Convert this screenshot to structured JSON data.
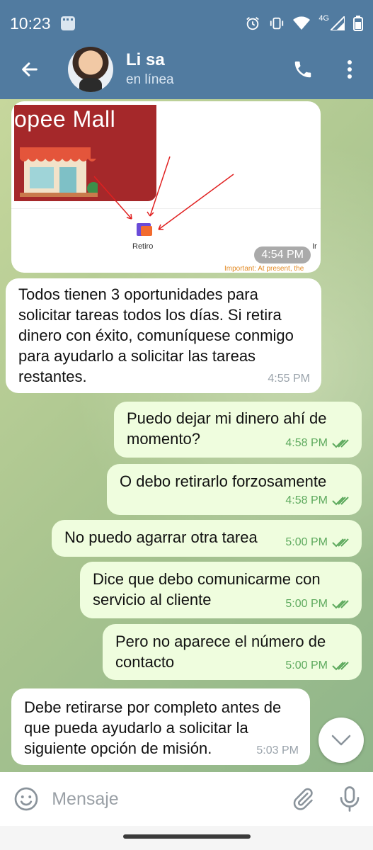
{
  "status_bar": {
    "time": "10:23",
    "network": "4G"
  },
  "header": {
    "title": "Li sa",
    "status": "en línea"
  },
  "image_message": {
    "banner_text": "opee Mall",
    "retiro_label": "Retiro",
    "side_label": "Ir",
    "important_text": "Important: At present, the",
    "time": "4:54 PM"
  },
  "messages": [
    {
      "direction": "in",
      "text": "Todos tienen 3 oportunidades para solicitar tareas todos los días. Si retira dinero con éxito, comuníquese conmigo para ayudarlo a solicitar las tareas restantes.",
      "time": "4:55 PM"
    },
    {
      "direction": "out",
      "text": "Puedo dejar mi dinero ahí de momento?",
      "time": "4:58 PM"
    },
    {
      "direction": "out",
      "text": "O debo retirarlo forzosamente",
      "time": "4:58 PM"
    },
    {
      "direction": "out",
      "text": "No puedo agarrar otra tarea",
      "time": "5:00 PM"
    },
    {
      "direction": "out",
      "text": "Dice que debo comunicarme con servicio al cliente",
      "time": "5:00 PM"
    },
    {
      "direction": "out",
      "text": "Pero no aparece el número de contacto",
      "time": "5:00 PM"
    },
    {
      "direction": "in",
      "text": "Debe retirarse por completo antes de que pueda ayudarlo a solicitar la siguiente opción de misión.",
      "time": "5:03 PM"
    }
  ],
  "input": {
    "placeholder": "Mensaje",
    "value": ""
  },
  "colors": {
    "header": "#517ba0",
    "outgoing_bubble": "#effdde",
    "incoming_bubble": "#ffffff",
    "read_check": "#5eaa5e"
  }
}
